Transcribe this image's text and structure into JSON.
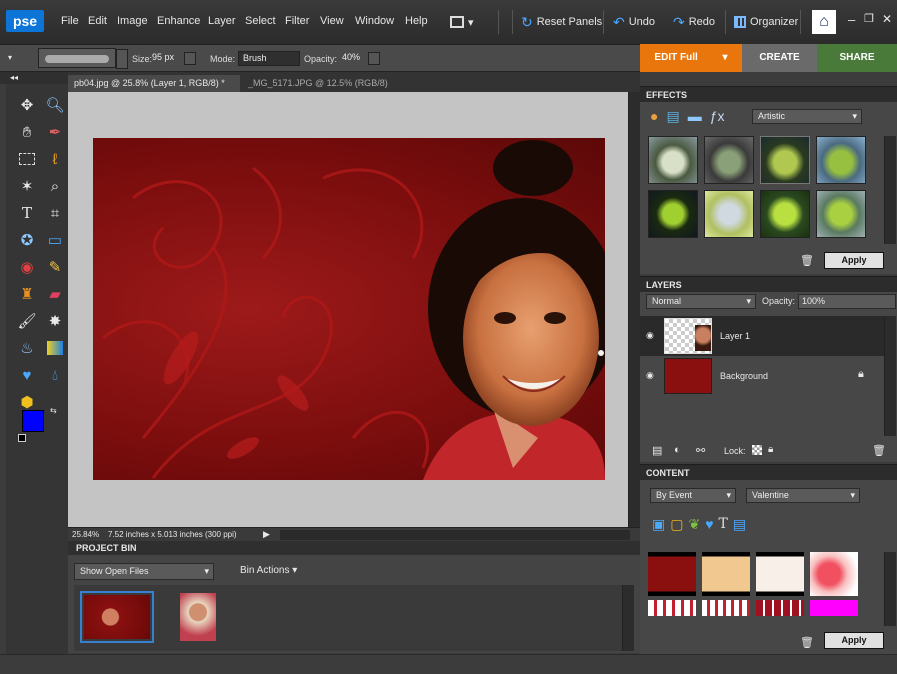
{
  "app": {
    "logo": "pse"
  },
  "menu": [
    "File",
    "Edit",
    "Image",
    "Enhance",
    "Layer",
    "Select",
    "Filter",
    "View",
    "Window",
    "Help"
  ],
  "toolbar": {
    "reset_panels": "Reset Panels",
    "undo": "Undo",
    "redo": "Redo",
    "organizer": "Organizer"
  },
  "options": {
    "size_label": "Size:",
    "size_value": "95 px",
    "mode_label": "Mode:",
    "mode_value": "Brush",
    "opacity_label": "Opacity:",
    "opacity_value": "40%"
  },
  "modes": {
    "edit": "EDIT Full",
    "create": "CREATE",
    "share": "SHARE"
  },
  "doc_tabs": [
    {
      "label": "pb04.jpg @ 25.8% (Layer 1, RGB/8) *",
      "active": true
    },
    {
      "label": "_MG_5171.JPG @ 12.5% (RGB/8) *",
      "active": false
    }
  ],
  "status": {
    "zoom": "25.84%",
    "info": "7.52 inches x 5.013 inches (300 ppi)"
  },
  "project_bin": {
    "title": "PROJECT BIN",
    "show": "Show Open Files",
    "actions": "Bin Actions"
  },
  "effects": {
    "title": "EFFECTS",
    "category": "Artistic",
    "apply": "Apply"
  },
  "layers": {
    "title": "LAYERS",
    "blend": "Normal",
    "opacity_label": "Opacity:",
    "opacity_value": "100%",
    "items": [
      {
        "name": "Layer 1"
      },
      {
        "name": "Background"
      }
    ],
    "lock_label": "Lock:"
  },
  "content": {
    "title": "CONTENT",
    "sort": "By Event",
    "event": "Valentine",
    "apply": "Apply"
  },
  "colors": {
    "accent_orange": "#e8760c",
    "create_gray": "#6a6a6a",
    "share_green": "#4a7a3a",
    "foreground": "#0000ff",
    "background": "#ffffff"
  }
}
